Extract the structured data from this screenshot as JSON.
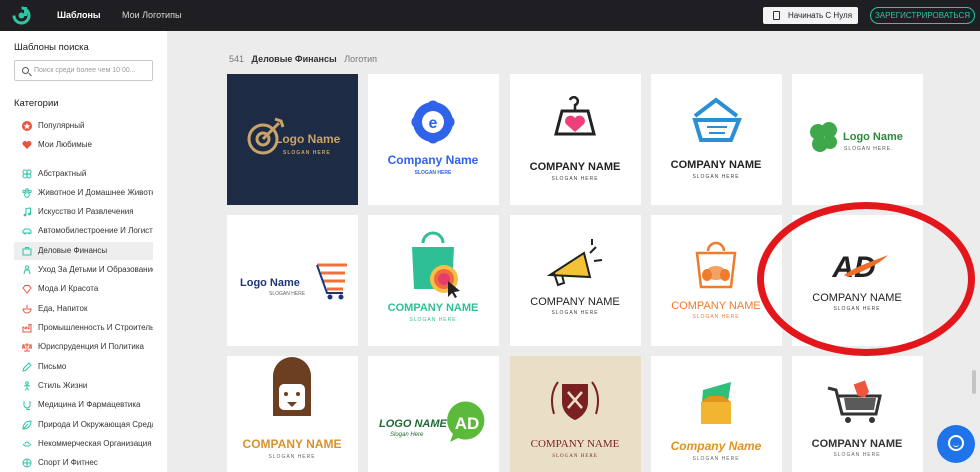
{
  "topbar": {
    "tabs": [
      {
        "label": "Шаблоны"
      },
      {
        "label": "Мои Логотипы"
      }
    ],
    "start_button": "Начинать С Нуля",
    "register_button": "ЗАРЕГИСТРИРОВАТЬСЯ"
  },
  "sidebar": {
    "search_title": "Шаблоны поиска",
    "search_placeholder": "Поиск среди более чем 10 00...",
    "categories_title": "Категории",
    "categories": [
      {
        "label": "Популярный",
        "icon": "star-icon"
      },
      {
        "label": "Мои Любимые",
        "icon": "heart-icon"
      },
      {
        "label": "Абстрактный",
        "icon": "abstract-icon"
      },
      {
        "label": "Животное И Домашнее Животное",
        "icon": "paw-icon"
      },
      {
        "label": "Искусство И Развлечения",
        "icon": "music-icon"
      },
      {
        "label": "Автомобилестроение И Логистика",
        "icon": "car-icon"
      },
      {
        "label": "Деловые Финансы",
        "icon": "briefcase-icon"
      },
      {
        "label": "Уход За Детьми И Образование",
        "icon": "child-icon"
      },
      {
        "label": "Мода И Красота",
        "icon": "diamond-icon"
      },
      {
        "label": "Еда, Напиток",
        "icon": "food-icon"
      },
      {
        "label": "Промышленность И Строительство",
        "icon": "factory-icon"
      },
      {
        "label": "Юриспруденция И Политика",
        "icon": "scales-icon"
      },
      {
        "label": "Письмо",
        "icon": "pen-icon"
      },
      {
        "label": "Стиль Жизни",
        "icon": "lifestyle-icon"
      },
      {
        "label": "Медицина И Фармацевтика",
        "icon": "medicine-icon"
      },
      {
        "label": "Природа И Окружающая Среда",
        "icon": "leaf-icon"
      },
      {
        "label": "Некоммерческая Организация",
        "icon": "hands-icon"
      },
      {
        "label": "Спорт И Фитнес",
        "icon": "sport-icon"
      }
    ]
  },
  "breadcrumb": {
    "count": "541",
    "category": "Деловые Финансы",
    "type": "Логотип"
  },
  "templates": [
    {
      "name": "Logo Name",
      "slogan": "SLOGAN HERE",
      "style": "dark-target"
    },
    {
      "name": "Company Name",
      "slogan": "SLOGAN HERE",
      "style": "blue-e"
    },
    {
      "name": "COMPANY NAME",
      "slogan": "SLOGAN HERE",
      "style": "hanger-heart"
    },
    {
      "name": "COMPANY NAME",
      "slogan": "SLOGAN HERE",
      "style": "house-basket"
    },
    {
      "name": "Logo Name",
      "slogan": "SLOGAN HERE.",
      "style": "clover"
    },
    {
      "name": "Logo Name",
      "slogan": "SLOGAN HERE",
      "style": "cart-e"
    },
    {
      "name": "COMPANY NAME",
      "slogan": "SLOGAN HERE",
      "style": "shopping-bag"
    },
    {
      "name": "COMPANY NAME",
      "slogan": "SLOGAN HERE",
      "style": "megaphone"
    },
    {
      "name": "COMPANY NAME",
      "slogan": "SLOGAN HERE",
      "style": "bread-bag"
    },
    {
      "mark": "AD",
      "name": "COMPANY NAME",
      "slogan": "SLOGAN HERE",
      "style": "ad-swoosh"
    },
    {
      "name": "COMPANY NAME",
      "slogan": "SLOGAN HERE",
      "style": "lion"
    },
    {
      "mark": "AD",
      "name": "LOGO NAME",
      "slogan": "Slogan Here",
      "style": "ad-bubble"
    },
    {
      "name": "COMPANY NAME",
      "slogan": "SLOGAN HERE",
      "style": "crest"
    },
    {
      "name": "Company Name",
      "slogan": "SLOGAN HERE",
      "style": "wallet"
    },
    {
      "name": "COMPANY NAME",
      "slogan": "SLOGAN HERE",
      "style": "cart-tag"
    }
  ],
  "colors": {
    "accent": "#2ec4a4",
    "annotation_ring": "#e3171b",
    "chat_button": "#1e74e8"
  }
}
